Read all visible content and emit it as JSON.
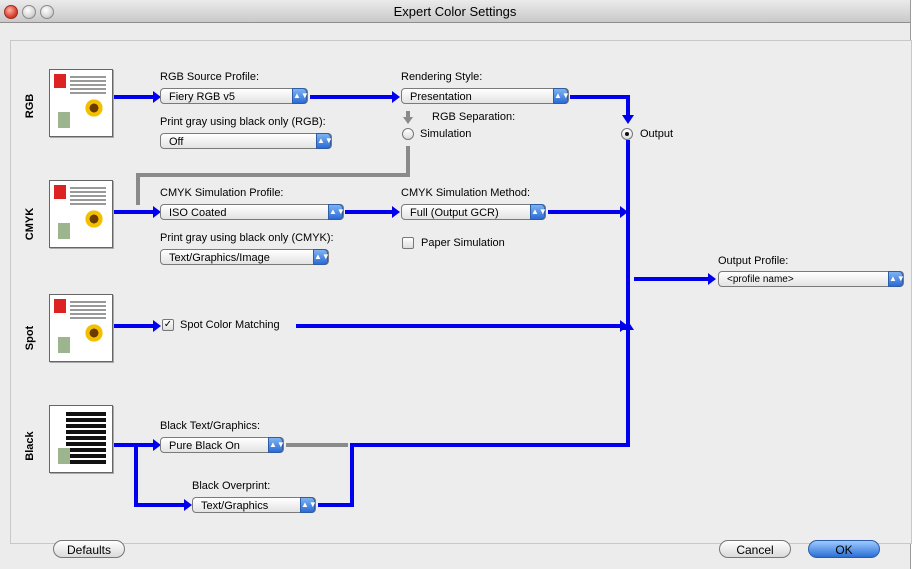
{
  "window": {
    "title": "Expert Color Settings"
  },
  "rows": {
    "rgb": "RGB",
    "cmyk": "CMYK",
    "spot": "Spot",
    "black": "Black"
  },
  "rgb": {
    "source_label": "RGB Source Profile:",
    "source_value": "Fiery RGB v5",
    "gray_label": "Print gray using black only (RGB):",
    "gray_value": "Off",
    "rendering_label": "Rendering Style:",
    "rendering_value": "Presentation",
    "separation_label": "RGB Separation:",
    "simulation_option": "Simulation",
    "output_option": "Output"
  },
  "cmyk": {
    "profile_label": "CMYK Simulation Profile:",
    "profile_value": "ISO Coated",
    "gray_label": "Print gray using black only (CMYK):",
    "gray_value": "Text/Graphics/Image",
    "method_label": "CMYK Simulation Method:",
    "method_value": "Full (Output GCR)",
    "paper_sim": "Paper Simulation"
  },
  "spot": {
    "matching": "Spot Color Matching"
  },
  "black": {
    "text_label": "Black Text/Graphics:",
    "text_value": "Pure Black On",
    "overprint_label": "Black Overprint:",
    "overprint_value": "Text/Graphics"
  },
  "output": {
    "profile_label": "Output Profile:",
    "profile_value": "<profile name>"
  },
  "buttons": {
    "defaults": "Defaults",
    "cancel": "Cancel",
    "ok": "OK"
  },
  "colors": {
    "flow": "#0000ee",
    "inactive_flow": "#8a8a8a",
    "accent": "#2b6fd6"
  }
}
